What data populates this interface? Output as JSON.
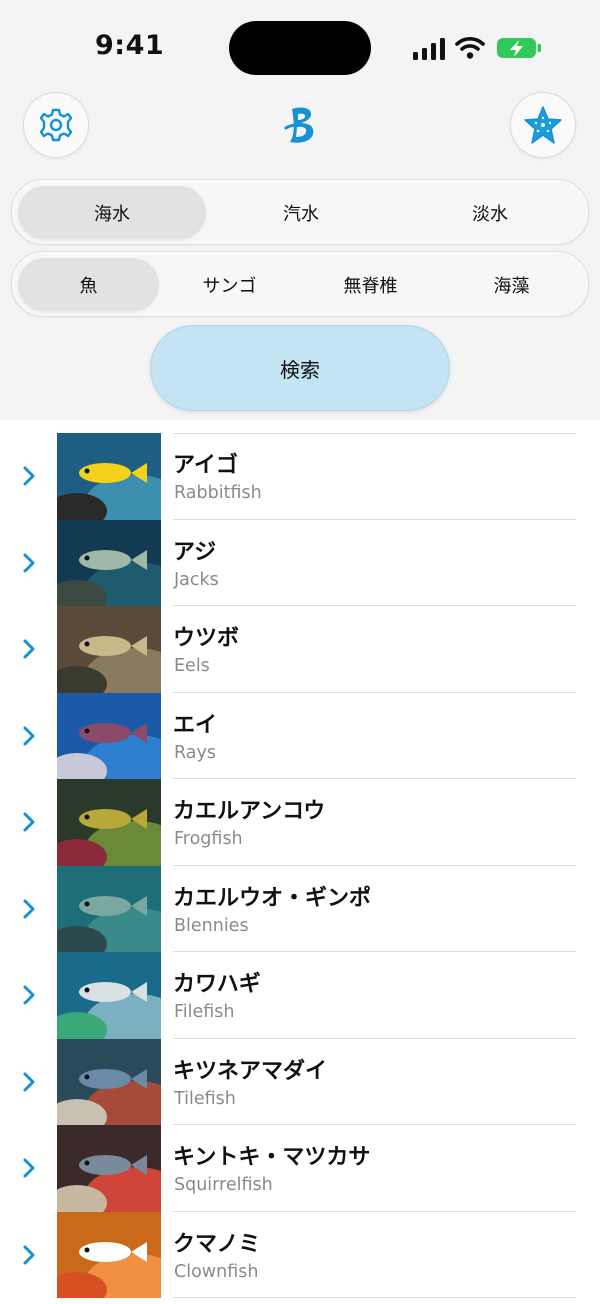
{
  "status_bar": {
    "time": "9:41"
  },
  "header": {
    "settings_icon": "gear-icon",
    "logo_icon": "b-logo-icon",
    "favorites_icon": "starfish-icon"
  },
  "water_types": {
    "selected": "海水",
    "options": [
      {
        "label": "海水"
      },
      {
        "label": "汽水"
      },
      {
        "label": "淡水"
      }
    ]
  },
  "categories": {
    "selected": "魚",
    "options": [
      {
        "label": "魚"
      },
      {
        "label": "サンゴ"
      },
      {
        "label": "無脊椎"
      },
      {
        "label": "海藻"
      }
    ]
  },
  "search": {
    "label": "検索"
  },
  "colors": {
    "accent": "#1592d4",
    "search_bg": "#c5e4f3",
    "secondary_text": "#8a8a8a"
  },
  "fish_list": [
    {
      "ja": "アイゴ",
      "en": "Rabbitfish"
    },
    {
      "ja": "アジ",
      "en": "Jacks"
    },
    {
      "ja": "ウツボ",
      "en": "Eels"
    },
    {
      "ja": "エイ",
      "en": "Rays"
    },
    {
      "ja": "カエルアンコウ",
      "en": "Frogfish"
    },
    {
      "ja": "カエルウオ・ギンポ",
      "en": "Blennies"
    },
    {
      "ja": "カワハギ",
      "en": "Filefish"
    },
    {
      "ja": "キツネアマダイ",
      "en": "Tilefish"
    },
    {
      "ja": "キントキ・マツカサ",
      "en": "Squirrelfish"
    },
    {
      "ja": "クマノミ",
      "en": "Clownfish"
    }
  ]
}
